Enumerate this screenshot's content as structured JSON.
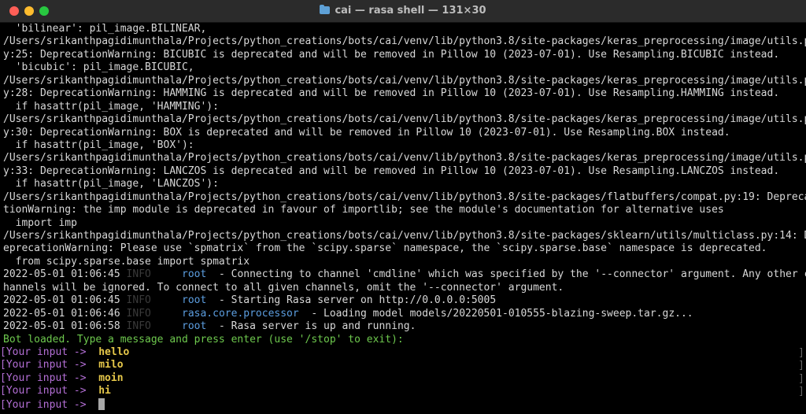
{
  "window": {
    "title": "cai — rasa shell — 131×30"
  },
  "lines": [
    "  'bilinear': pil_image.BILINEAR,",
    "/Users/srikanthpagidimunthala/Projects/python_creations/bots/cai/venv/lib/python3.8/site-packages/keras_preprocessing/image/utils.p",
    "y:25: DeprecationWarning: BICUBIC is deprecated and will be removed in Pillow 10 (2023-07-01). Use Resampling.BICUBIC instead.",
    "  'bicubic': pil_image.BICUBIC,",
    "/Users/srikanthpagidimunthala/Projects/python_creations/bots/cai/venv/lib/python3.8/site-packages/keras_preprocessing/image/utils.p",
    "y:28: DeprecationWarning: HAMMING is deprecated and will be removed in Pillow 10 (2023-07-01). Use Resampling.HAMMING instead.",
    "  if hasattr(pil_image, 'HAMMING'):",
    "/Users/srikanthpagidimunthala/Projects/python_creations/bots/cai/venv/lib/python3.8/site-packages/keras_preprocessing/image/utils.p",
    "y:30: DeprecationWarning: BOX is deprecated and will be removed in Pillow 10 (2023-07-01). Use Resampling.BOX instead.",
    "  if hasattr(pil_image, 'BOX'):",
    "/Users/srikanthpagidimunthala/Projects/python_creations/bots/cai/venv/lib/python3.8/site-packages/keras_preprocessing/image/utils.p",
    "y:33: DeprecationWarning: LANCZOS is deprecated and will be removed in Pillow 10 (2023-07-01). Use Resampling.LANCZOS instead.",
    "  if hasattr(pil_image, 'LANCZOS'):",
    "/Users/srikanthpagidimunthala/Projects/python_creations/bots/cai/venv/lib/python3.8/site-packages/flatbuffers/compat.py:19: Depreca",
    "tionWarning: the imp module is deprecated in favour of importlib; see the module's documentation for alternative uses",
    "  import imp",
    "/Users/srikanthpagidimunthala/Projects/python_creations/bots/cai/venv/lib/python3.8/site-packages/sklearn/utils/multiclass.py:14: D",
    "eprecationWarning: Please use `spmatrix` from the `scipy.sparse` namespace, the `scipy.sparse.base` namespace is deprecated.",
    "  from scipy.sparse.base import spmatrix"
  ],
  "logs": [
    {
      "ts": "2022-05-01 01:06:45",
      "level": "INFO",
      "logger": "root",
      "msg": "  - Connecting to channel 'cmdline' which was specified by the '--connector' argument. Any other c"
    },
    {
      "ts": "",
      "level": "",
      "logger": "",
      "msg": "hannels will be ignored. To connect to all given channels, omit the '--connector' argument."
    },
    {
      "ts": "2022-05-01 01:06:45",
      "level": "INFO",
      "logger": "root",
      "msg": "  - Starting Rasa server on http://0.0.0.0:5005"
    },
    {
      "ts": "2022-05-01 01:06:46",
      "level": "INFO",
      "logger": "rasa.core.processor",
      "msg": "  - Loading model models/20220501-010555-blazing-sweep.tar.gz..."
    },
    {
      "ts": "2022-05-01 01:06:58",
      "level": "INFO",
      "logger": "root",
      "msg": "  - Rasa server is up and running."
    }
  ],
  "bot_loaded": "Bot loaded. Type a message and press enter (use '/stop' to exit):",
  "prompt": "[Your input ->",
  "inputs": [
    "hello",
    "milo",
    "moin",
    "hi",
    ""
  ],
  "colors": {
    "background": "#000000",
    "prompt": "#b46fd6",
    "message": "#e6c84a",
    "bot_text": "#6ec94e",
    "logger": "#5c9ee0"
  }
}
